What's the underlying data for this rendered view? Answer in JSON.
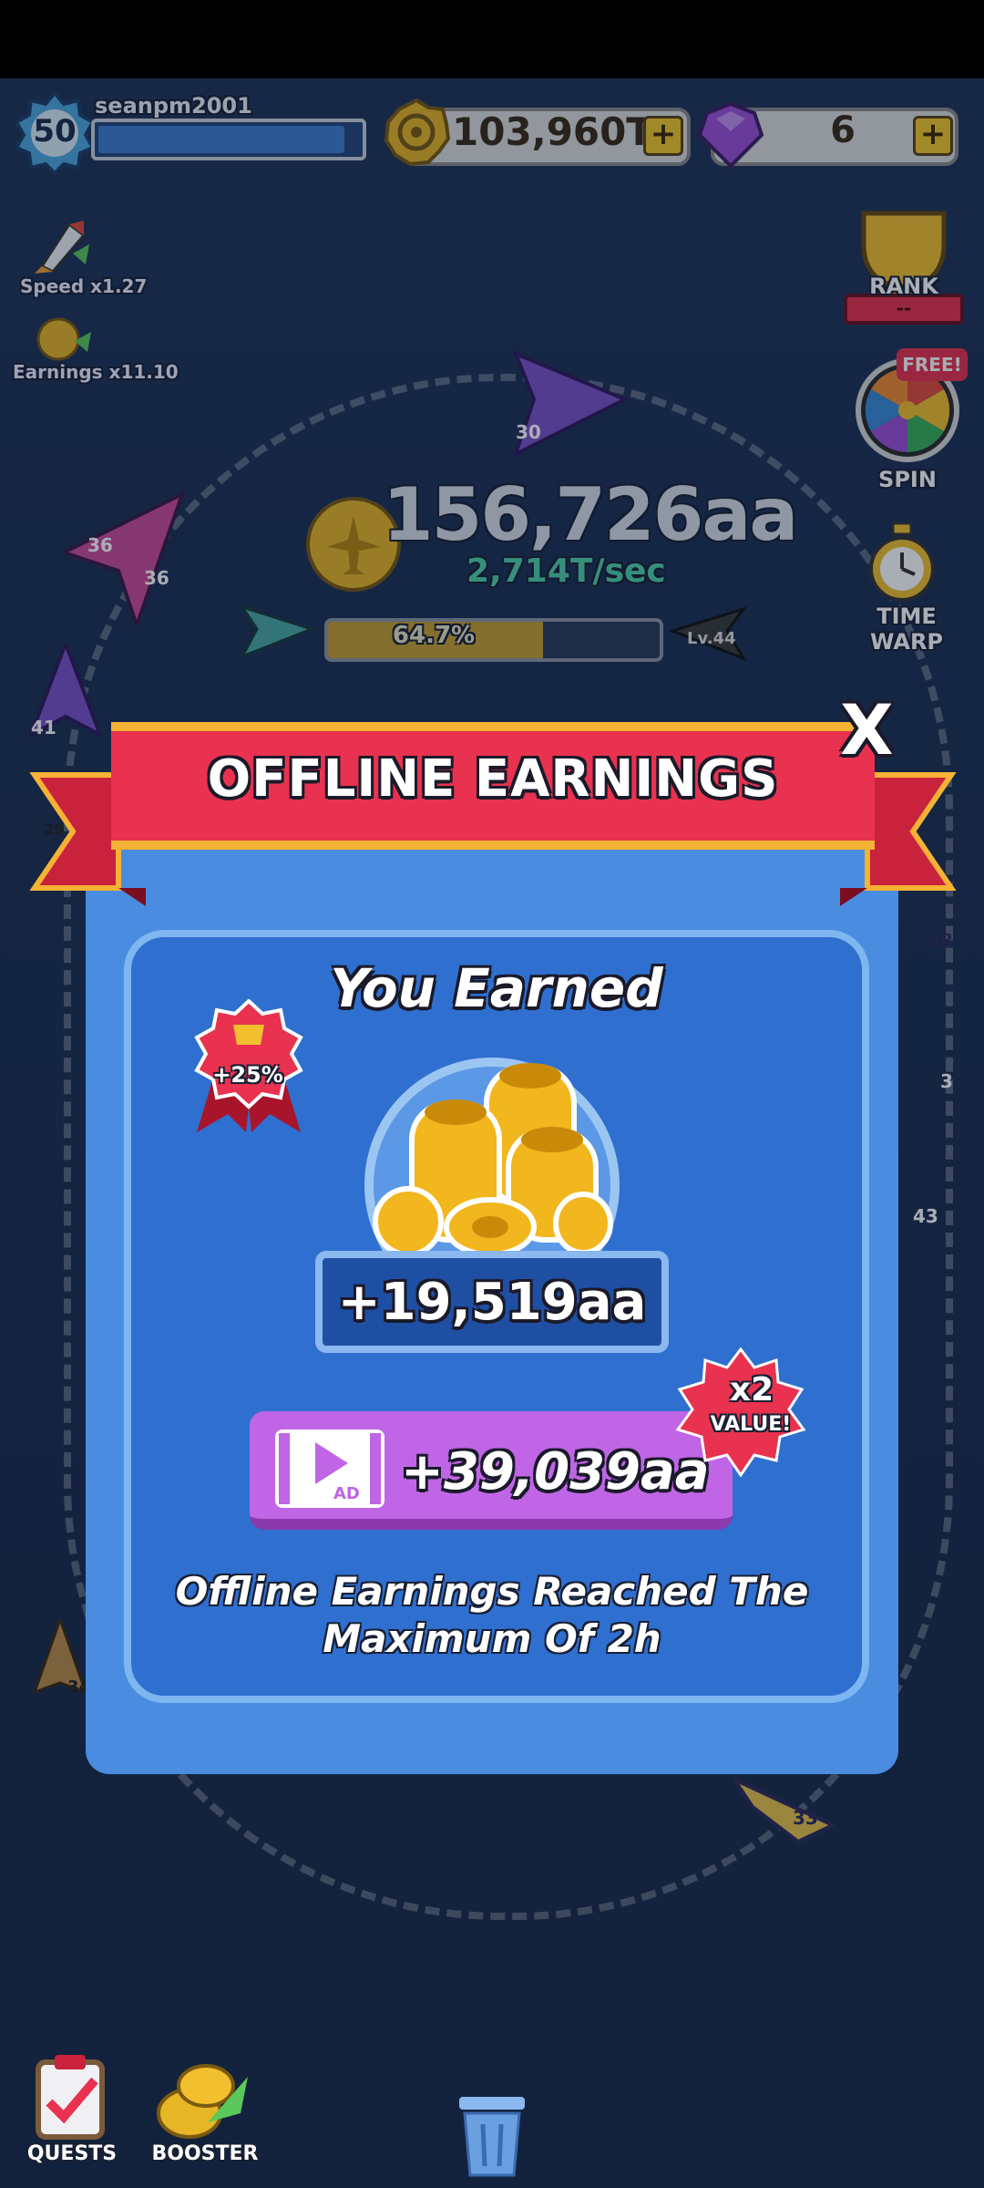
{
  "player": {
    "username": "seanpm2001",
    "level": "50",
    "xp_fraction": 0.92
  },
  "currency": {
    "coins": "103,960T",
    "gems": "6",
    "add_symbol": "+"
  },
  "boosts": {
    "speed": "Speed x1.27",
    "earnings": "Earnings x11.10"
  },
  "right_menu": {
    "rank": "RANK",
    "rank_sub": "--",
    "free_badge": "FREE!",
    "spin": "SPIN",
    "time_warp": "TIME WARP"
  },
  "planes": [
    "36",
    "36",
    "30",
    "41",
    "29",
    "34",
    "33",
    "38",
    "43",
    "3"
  ],
  "main": {
    "total": "156,726aa",
    "rate": "2,714T/sec",
    "progress_text": "64.7%",
    "progress_value": 0.647,
    "next_level": "Lv.44"
  },
  "modal": {
    "title": "OFFLINE EARNINGS",
    "close": "X",
    "heading": "You Earned",
    "bonus_badge": "+25%",
    "earned": "+19,519aa",
    "ad_label": "AD",
    "ad_value": "+39,039aa",
    "x2_top": "x2",
    "x2_bottom": "VALUE!",
    "note": "Offline Earnings Reached The Maximum Of 2h"
  },
  "bottom_nav": {
    "quests": "QUESTS",
    "booster": "BOOSTER"
  },
  "colors": {
    "ribbon": "#e8324f",
    "modal": "#4a8ce0",
    "ad_button": "#c065e6",
    "accent_gold": "#f5b234",
    "rate_green": "#4fd1a8"
  }
}
